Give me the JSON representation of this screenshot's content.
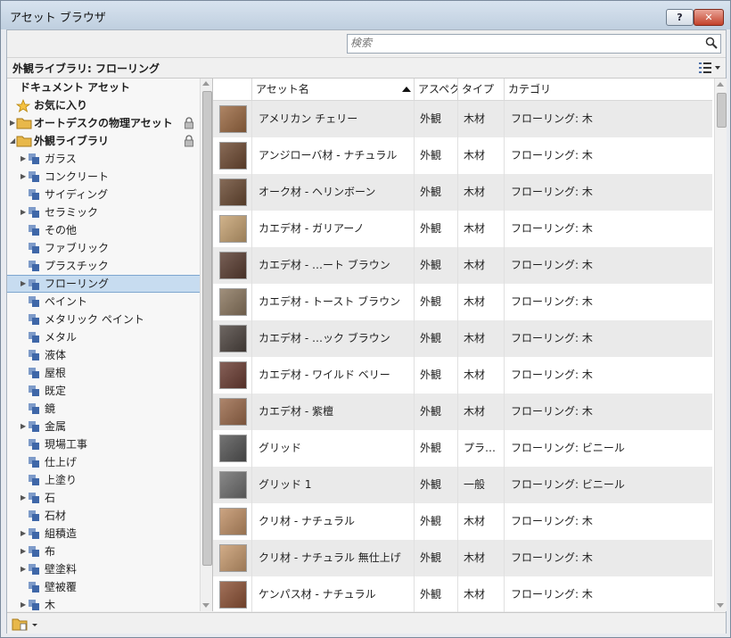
{
  "window": {
    "title": "アセット ブラウザ",
    "help_label": "?",
    "close_label": "✕"
  },
  "search": {
    "placeholder": "検索"
  },
  "location": "外観ライブラリ: フローリング",
  "tree": [
    {
      "label": "ドキュメント アセット",
      "level": 0,
      "type": "doc",
      "bold": true
    },
    {
      "label": "お気に入り",
      "level": 0,
      "type": "star",
      "bold": true
    },
    {
      "label": "オートデスクの物理アセット",
      "level": 0,
      "type": "folder",
      "bold": true,
      "expander": "collapsed",
      "locked": true
    },
    {
      "label": "外観ライブラリ",
      "level": 0,
      "type": "folder",
      "bold": true,
      "expander": "expanded",
      "locked": true
    },
    {
      "label": "ガラス",
      "level": 1,
      "type": "lib",
      "expander": "collapsed"
    },
    {
      "label": "コンクリート",
      "level": 1,
      "type": "lib",
      "expander": "collapsed"
    },
    {
      "label": "サイディング",
      "level": 1,
      "type": "lib"
    },
    {
      "label": "セラミック",
      "level": 1,
      "type": "lib",
      "expander": "collapsed"
    },
    {
      "label": "その他",
      "level": 1,
      "type": "lib"
    },
    {
      "label": "ファブリック",
      "level": 1,
      "type": "lib"
    },
    {
      "label": "プラスチック",
      "level": 1,
      "type": "lib"
    },
    {
      "label": "フローリング",
      "level": 1,
      "type": "lib",
      "expander": "collapsed",
      "selected": true
    },
    {
      "label": "ペイント",
      "level": 1,
      "type": "lib"
    },
    {
      "label": "メタリック ペイント",
      "level": 1,
      "type": "lib"
    },
    {
      "label": "メタル",
      "level": 1,
      "type": "lib"
    },
    {
      "label": "液体",
      "level": 1,
      "type": "lib"
    },
    {
      "label": "屋根",
      "level": 1,
      "type": "lib"
    },
    {
      "label": "既定",
      "level": 1,
      "type": "lib"
    },
    {
      "label": "鏡",
      "level": 1,
      "type": "lib"
    },
    {
      "label": "金属",
      "level": 1,
      "type": "lib",
      "expander": "collapsed"
    },
    {
      "label": "現場工事",
      "level": 1,
      "type": "lib"
    },
    {
      "label": "仕上げ",
      "level": 1,
      "type": "lib"
    },
    {
      "label": "上塗り",
      "level": 1,
      "type": "lib"
    },
    {
      "label": "石",
      "level": 1,
      "type": "lib",
      "expander": "collapsed"
    },
    {
      "label": "石材",
      "level": 1,
      "type": "lib"
    },
    {
      "label": "組積造",
      "level": 1,
      "type": "lib",
      "expander": "collapsed"
    },
    {
      "label": "布",
      "level": 1,
      "type": "lib",
      "expander": "collapsed"
    },
    {
      "label": "壁塗料",
      "level": 1,
      "type": "lib",
      "expander": "collapsed"
    },
    {
      "label": "壁被覆",
      "level": 1,
      "type": "lib"
    },
    {
      "label": "木",
      "level": 1,
      "type": "lib",
      "expander": "collapsed"
    }
  ],
  "table": {
    "columns": [
      "",
      "アセット名",
      "アスペク",
      "タイプ",
      "カテゴリ"
    ],
    "rows": [
      {
        "name": "アメリカン チェリー",
        "aspect": "外観",
        "type": "木材",
        "category": "フローリング: 木",
        "swatch": "#9c6a43"
      },
      {
        "name": "アンジローバ材 - ナチュラル",
        "aspect": "外観",
        "type": "木材",
        "category": "フローリング: 木",
        "swatch": "#6e4a32"
      },
      {
        "name": "オーク材 - ヘリンボーン",
        "aspect": "外観",
        "type": "木材",
        "category": "フローリング: 木",
        "swatch": "#6a4a33"
      },
      {
        "name": "カエデ材 - ガリアーノ",
        "aspect": "外観",
        "type": "木材",
        "category": "フローリング: 木",
        "swatch": "#c6a272"
      },
      {
        "name": "カエデ材 - …ート ブラウン",
        "aspect": "外観",
        "type": "木材",
        "category": "フローリング: 木",
        "swatch": "#5a3d31"
      },
      {
        "name": "カエデ材 - トースト ブラウン",
        "aspect": "外観",
        "type": "木材",
        "category": "フローリング: 木",
        "swatch": "#8b775f"
      },
      {
        "name": "カエデ材 - …ック ブラウン",
        "aspect": "外観",
        "type": "木材",
        "category": "フローリング: 木",
        "swatch": "#4e4540"
      },
      {
        "name": "カエデ材 - ワイルド ベリー",
        "aspect": "外観",
        "type": "木材",
        "category": "フローリング: 木",
        "swatch": "#6b3d33"
      },
      {
        "name": "カエデ材 - 紫檀",
        "aspect": "外観",
        "type": "木材",
        "category": "フローリング: 木",
        "swatch": "#9b6a4b"
      },
      {
        "name": "グリッド",
        "aspect": "外観",
        "type": "プラ…",
        "category": "フローリング: ビニール",
        "swatch": "#555555"
      },
      {
        "name": "グリッド 1",
        "aspect": "外観",
        "type": "一般",
        "category": "フローリング: ビニール",
        "swatch": "#6e6e6e"
      },
      {
        "name": "クリ材 - ナチュラル",
        "aspect": "外観",
        "type": "木材",
        "category": "フローリング: 木",
        "swatch": "#c09066"
      },
      {
        "name": "クリ材 - ナチュラル 無仕上げ",
        "aspect": "外観",
        "type": "木材",
        "category": "フローリング: 木",
        "swatch": "#c79a6e"
      },
      {
        "name": "ケンパス材 - ナチュラル",
        "aspect": "外観",
        "type": "木材",
        "category": "フローリング: 木",
        "swatch": "#8d5236"
      }
    ]
  },
  "colors": {
    "selection": "#c7dcf0",
    "title_gradient_top": "#d8e3ef",
    "close_red": "#c3412a",
    "folder": "#e8b84a",
    "lib_icon": "#4a6ea8"
  }
}
